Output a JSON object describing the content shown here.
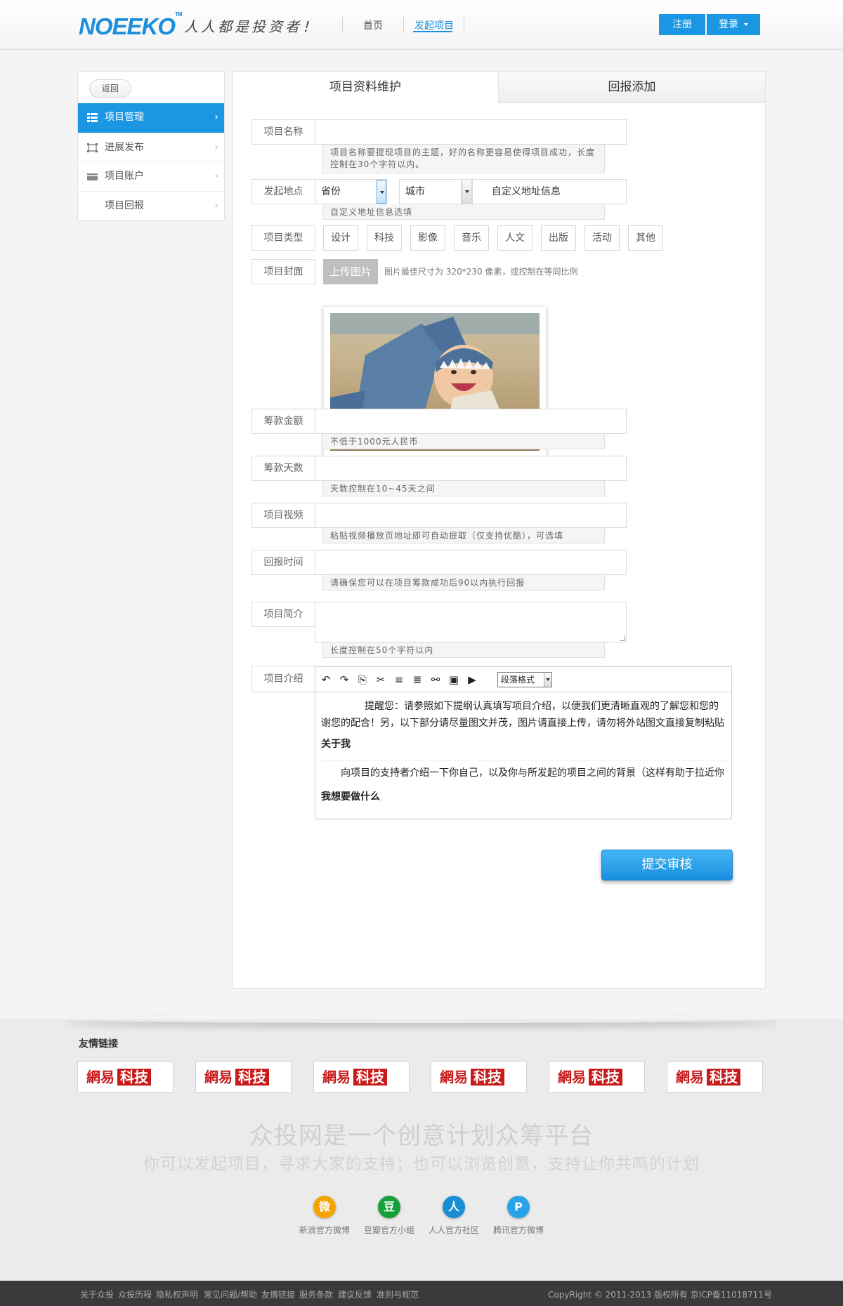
{
  "header": {
    "logo": "NOEEKO",
    "logo_tm": "TM",
    "slogan": "人人都是投资者！",
    "nav": [
      "首页",
      "发起项目"
    ],
    "register": "注册",
    "login": "登录"
  },
  "sidebar": {
    "back": "返回",
    "items": [
      {
        "label": "项目管理",
        "icon": "grid-icon"
      },
      {
        "label": "进展发布",
        "icon": "frame-icon"
      },
      {
        "label": "项目账户",
        "icon": "card-icon"
      },
      {
        "label": "项目回报",
        "icon": ""
      }
    ]
  },
  "tabs": [
    "项目资料维护",
    "回报添加"
  ],
  "form": {
    "name": {
      "label": "项目名称",
      "value": "",
      "hint": "项目名称要提现项目的主题，好的名称更容易使得项目成功，长度控制在30个字符以内。"
    },
    "location": {
      "label": "发起地点",
      "province": "省份",
      "city": "城市",
      "custom": "自定义地址信息",
      "hint": "自定义地址信息选填"
    },
    "type": {
      "label": "项目类型",
      "options": [
        "设计",
        "科技",
        "影像",
        "音乐",
        "人文",
        "出版",
        "活动",
        "其他"
      ]
    },
    "cover": {
      "label": "项目封面",
      "upload": "上传图片",
      "note": "图片最佳尺寸为 320*230 像素，或控制在等同比例"
    },
    "amount": {
      "label": "筹款金额",
      "value": "",
      "hint": "不低于1000元人民币"
    },
    "days": {
      "label": "筹款天数",
      "value": "",
      "hint": "天数控制在10~45天之间"
    },
    "video": {
      "label": "项目视频",
      "value": "",
      "hint": "粘贴视频播放页地址即可自动提取（仅支持优酷），可选填"
    },
    "reward_time": {
      "label": "回报时间",
      "value": "",
      "hint": "请确保您可以在项目筹款成功后90以内执行回报"
    },
    "summary": {
      "label": "项目简介",
      "value": "",
      "hint": "长度控制在50个字符以内"
    },
    "intro": {
      "label": "项目介绍",
      "para_format": "段落格式",
      "reminder": "提醒您：请参照如下提纲认真填写项目介绍，以便我们更清晰直观的了解您和您的谢您的配合！另，以下部分请尽量图文并茂，图片请直接上传，请勿将外站图文直接复制粘贴",
      "heading1": "关于我",
      "para1": "向项目的支持者介绍一下你自己，以及你与所发起的项目之间的背景（这样有助于拉近你",
      "heading2": "我想要做什么"
    },
    "submit": "提交审核"
  },
  "footer": {
    "friend_title": "友情链接",
    "friend_links": [
      {
        "a": "網易",
        "b": "科技"
      },
      {
        "a": "網易",
        "b": "科技"
      },
      {
        "a": "網易",
        "b": "科技"
      },
      {
        "a": "網易",
        "b": "科技"
      },
      {
        "a": "網易",
        "b": "科技"
      },
      {
        "a": "網易",
        "b": "科技"
      }
    ],
    "slogan": "众投网是一个创意计划众筹平台",
    "sub_slogan": "你可以发起项目，寻求大家的支持；也可以浏览创意，支持让你共鸣的计划",
    "social": [
      {
        "label": "新浪官方微博",
        "glyph": "微",
        "color": "#f5a300",
        "icon": "weibo-icon"
      },
      {
        "label": "豆瓣官方小组",
        "glyph": "豆",
        "color": "#17a03a",
        "icon": "douban-icon"
      },
      {
        "label": "人人官方社区",
        "glyph": "人",
        "color": "#1a8fd6",
        "icon": "renren-icon"
      },
      {
        "label": "腾讯官方微博",
        "glyph": "P",
        "color": "#2aa2e8",
        "icon": "tencent-weibo-icon"
      }
    ],
    "bottom_links": [
      "关于众投",
      "众投历程",
      "隐私权声明",
      "常见问题/帮助",
      "友情链接",
      "服务条款",
      "建议反馈",
      "准则与规范"
    ],
    "copyright": "CopyRight © 2011-2013    版权所有  京ICP备11018711号"
  }
}
